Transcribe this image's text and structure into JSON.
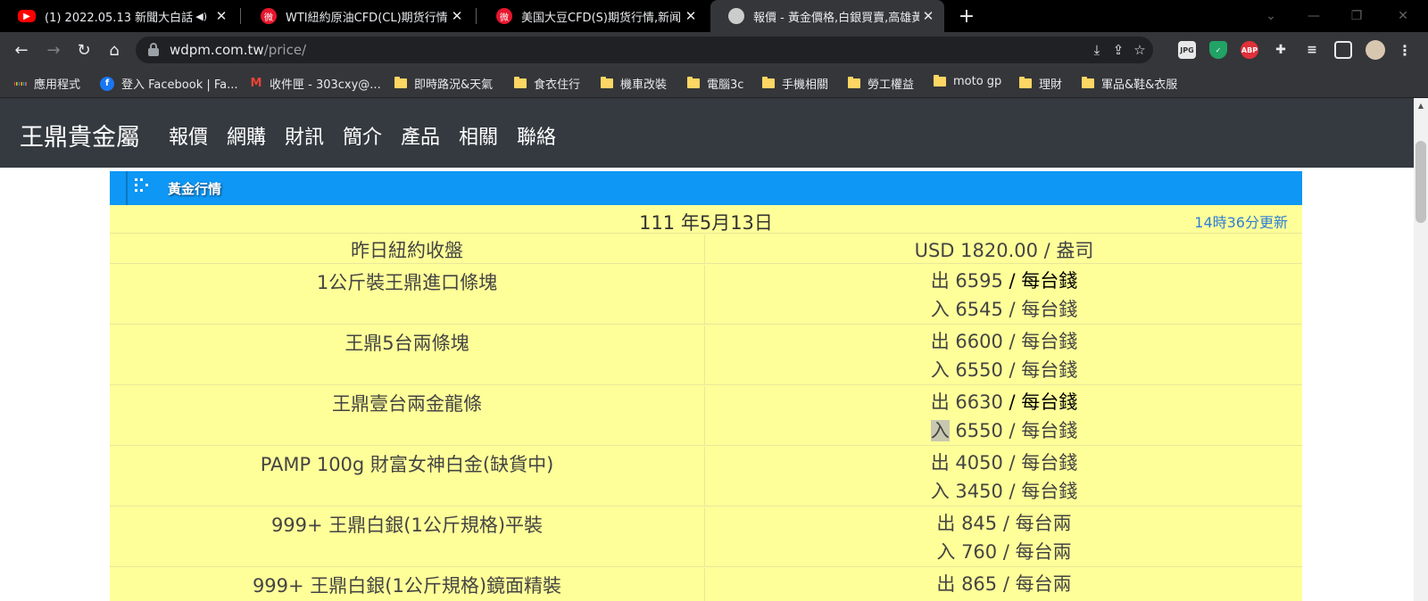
{
  "tabs": [
    {
      "title": "(1) 2022.05.13 新聞大白話【",
      "favicon": "youtube-icon",
      "color": "#ff0000"
    },
    {
      "title": "WTI紐約原油CFD(CL)期货行情,新",
      "favicon": "weibo-icon",
      "color": "#e6162d"
    },
    {
      "title": "美国大豆CFD(S)期货行情,新闻,报",
      "favicon": "weibo-icon",
      "color": "#e6162d"
    },
    {
      "title": "報價 - 黃金價格,白銀買賣,高雄黃",
      "favicon": "site-icon",
      "color": "#cccccc"
    }
  ],
  "address": {
    "domain": "wdpm.com.tw",
    "path": "/price/"
  },
  "bookmarks": [
    {
      "label": "應用程式",
      "icon": "apps-grid-icon"
    },
    {
      "label": "登入 Facebook | Fa...",
      "icon": "facebook-icon"
    },
    {
      "label": "收件匣 - 303cxy@...",
      "icon": "gmail-icon"
    },
    {
      "label": "即時路況&天氣",
      "icon": "folder-icon"
    },
    {
      "label": "食衣住行",
      "icon": "folder-icon"
    },
    {
      "label": "機車改裝",
      "icon": "folder-icon"
    },
    {
      "label": "電腦3c",
      "icon": "folder-icon"
    },
    {
      "label": "手機相關",
      "icon": "folder-icon"
    },
    {
      "label": "勞工權益",
      "icon": "folder-icon"
    },
    {
      "label": "moto gp",
      "icon": "folder-icon"
    },
    {
      "label": "理財",
      "icon": "folder-icon"
    },
    {
      "label": "軍品&鞋&衣服",
      "icon": "folder-icon"
    }
  ],
  "site": {
    "brand": "王鼎貴金屬",
    "nav": [
      "報價",
      "網購",
      "財訊",
      "簡介",
      "產品",
      "相關",
      "聯絡"
    ]
  },
  "panel": {
    "title": "黃金行情",
    "date": "111 年5月13日",
    "updated": "14時36分更新",
    "close_label": "昨日紐約收盤",
    "close_value": "USD 1820.00 / 盎司",
    "products": [
      {
        "name": "1公斤裝王鼎進口條塊",
        "sell_prefix": "出",
        "sell": "6595",
        "sell_unit": "/ 每台錢",
        "buy_prefix": "入",
        "buy": "6545",
        "buy_unit": "/ 每台錢"
      },
      {
        "name": "王鼎5台兩條塊",
        "sell_prefix": "出",
        "sell": "6600",
        "sell_unit": "/ 每台錢",
        "buy_prefix": "入",
        "buy": "6550",
        "buy_unit": "/ 每台錢"
      },
      {
        "name": "王鼎壹台兩金龍條",
        "sell_prefix": "出",
        "sell": "6630",
        "sell_unit": "/ 每台錢",
        "buy_prefix": "入",
        "buy": "6550",
        "buy_unit": "/ 每台錢"
      },
      {
        "name": "PAMP 100g 財富女神白金(缺貨中)",
        "sell_prefix": "出",
        "sell": "4050",
        "sell_unit": "/ 每台錢",
        "buy_prefix": "入",
        "buy": "3450",
        "buy_unit": "/ 每台錢"
      },
      {
        "name": "999+ 王鼎白銀(1公斤規格)平裝",
        "sell_prefix": "出",
        "sell": "845",
        "sell_unit": "/ 每台兩",
        "buy_prefix": "入",
        "buy": "760",
        "buy_unit": "/ 每台兩"
      },
      {
        "name": "999+ 王鼎白銀(1公斤規格)鏡面精裝",
        "sell_prefix": "出",
        "sell": "865",
        "sell_unit": "/ 每台兩"
      }
    ]
  }
}
